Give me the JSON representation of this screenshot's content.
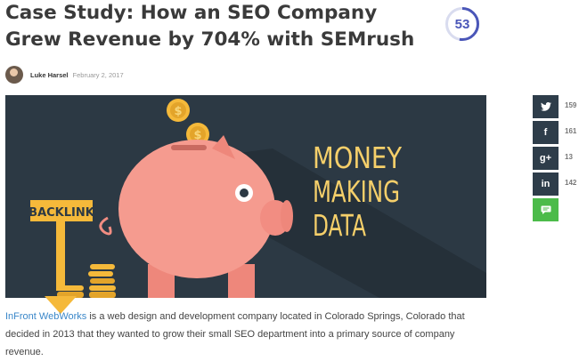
{
  "article": {
    "title": "Case Study: How an SEO Company Grew Revenue by 704% with SEMrush",
    "score": "53",
    "author": "Luke Harsel",
    "date": "February 2, 2017"
  },
  "hero": {
    "headline_lines": [
      "MONEY",
      "MAKING",
      "DATA"
    ],
    "backlink_label": "BACKLINK",
    "coin_symbol": "$"
  },
  "share": [
    {
      "icon": "twitter-icon",
      "glyph": "🐦",
      "count": "159"
    },
    {
      "icon": "facebook-icon",
      "glyph": "f",
      "count": "161"
    },
    {
      "icon": "google-plus-icon",
      "glyph": "g+",
      "count": "13"
    },
    {
      "icon": "linkedin-icon",
      "glyph": "in",
      "count": "142"
    },
    {
      "icon": "comment-icon",
      "glyph": "▬",
      "count": ""
    }
  ],
  "body": {
    "link_text": "InFront WebWorks",
    "text": " is a web design and development company located in Colorado Springs, Colorado that decided in 2013 that they wanted to grow their small SEO department into a primary source of company revenue."
  },
  "colors": {
    "share_bg": "#2e3d4a",
    "comment_bg": "#4cbb4a",
    "link": "#3a87c9",
    "score_ring": "#4a56b8"
  }
}
